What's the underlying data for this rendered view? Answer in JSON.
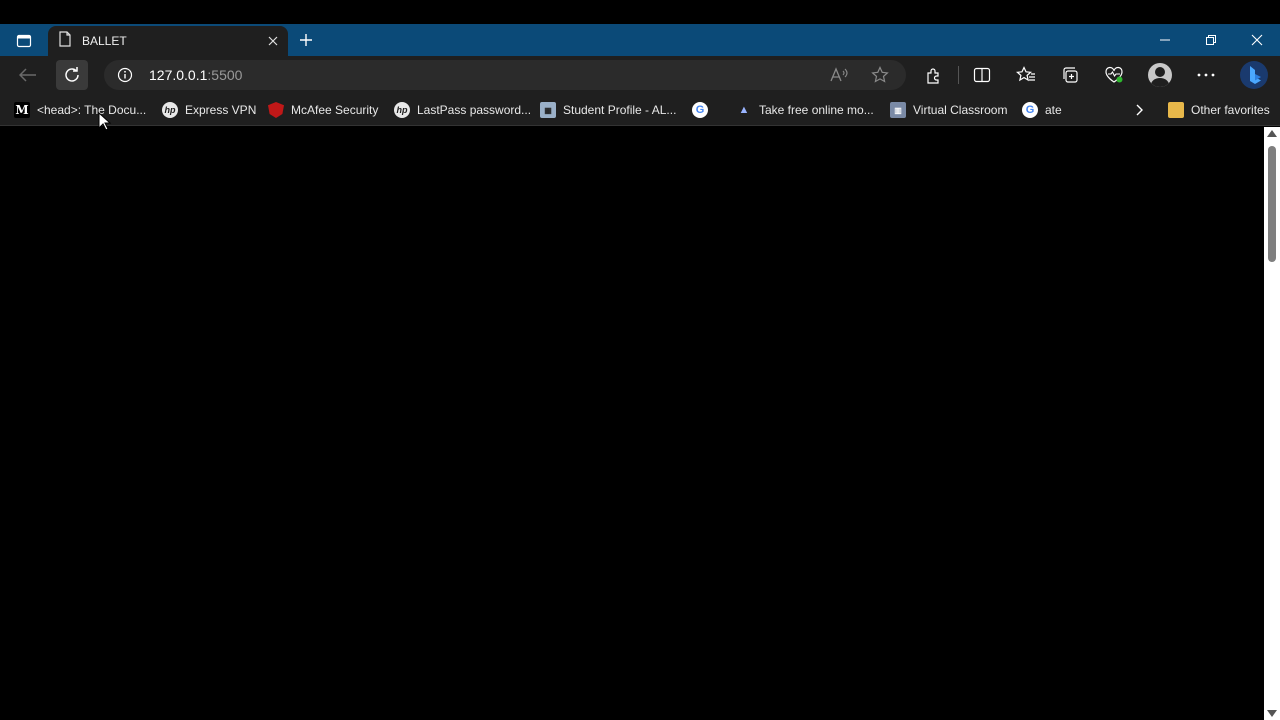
{
  "window": {
    "tab_title": "BALLET",
    "icons": [
      "tab-actions-icon",
      "page-icon",
      "close-icon",
      "plus-icon",
      "minimize-icon",
      "maximize-icon",
      "close-icon"
    ]
  },
  "address_bar": {
    "host": "127.0.0.1",
    "port": ":5500"
  },
  "toolbar_icons": [
    "back-arrow-icon",
    "refresh-icon",
    "info-icon",
    "read-aloud-icon",
    "star-icon",
    "extensions-icon",
    "split-screen-icon",
    "favorites-icon",
    "collections-icon",
    "browser-essentials-icon",
    "profile-icon",
    "more-icon",
    "bing-copilot-icon"
  ],
  "bookmarks": {
    "items": [
      {
        "label": "<head>: The Docu...",
        "icon": "mdn-icon"
      },
      {
        "label": "Express VPN",
        "icon": "hp-icon"
      },
      {
        "label": "McAfee Security",
        "icon": "mcafee-icon"
      },
      {
        "label": "LastPass password...",
        "icon": "hp-icon"
      },
      {
        "label": "Student Profile - AL...",
        "icon": "student-icon"
      },
      {
        "label": "",
        "icon": "google-icon"
      },
      {
        "label": "Take free online mo...",
        "icon": "take-icon"
      },
      {
        "label": "Virtual Classroom",
        "icon": "classroom-icon"
      },
      {
        "label": "ate",
        "icon": "google-icon"
      }
    ],
    "other_favorites": "Other favorites"
  },
  "colors": {
    "titlebar": "#0b4a78",
    "toolbar": "#1f1f1f",
    "content": "#000000"
  }
}
